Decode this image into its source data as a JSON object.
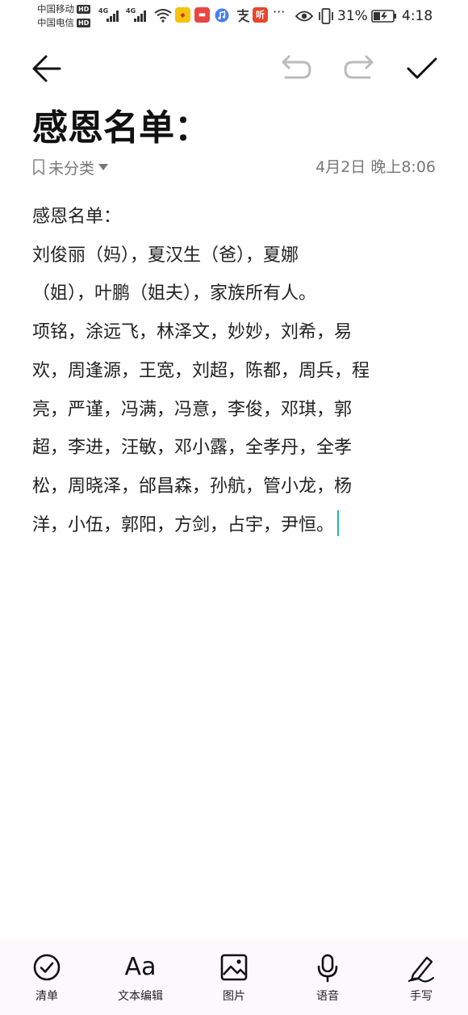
{
  "status_bar": {
    "carrier_1": "中国移动",
    "carrier_2": "中国电信",
    "hd_badge": "HD",
    "network_type": "4G",
    "battery_percent": "31%",
    "time": "4:18",
    "more_indicator": "···",
    "icons": [
      "signal-icon",
      "wifi-icon",
      "app-notification-icon",
      "music-icon",
      "alipay-icon",
      "ting-icon",
      "eye-icon",
      "vibrate-icon",
      "battery-icon"
    ]
  },
  "toolbar": {
    "back": "back-arrow-icon",
    "undo": "undo-icon",
    "redo": "redo-icon",
    "done": "checkmark-icon"
  },
  "note": {
    "title": "感恩名单：",
    "category": "未分类",
    "date": "4月2日 晚上8:06",
    "lines": [
      "感恩名单：",
      "刘俊丽（妈），夏汉生（爸），夏娜",
      "（姐），叶鹏（姐夫），家族所有人。",
      "项铭，涂远飞，林泽文，妙妙，刘希，易",
      "欢，周逢源，王宽，刘超，陈都，周兵，程",
      "亮，严谨，冯满，冯意，李俊，邓琪，郭",
      "超，李进，汪敏，邓小露，全孝丹，全孝",
      "松，周晓泽，邰昌森，孙航，管小龙，杨",
      "洋，小伍，郭阳，方剑，占宇，尹恒。"
    ]
  },
  "bottom_bar": {
    "items": [
      {
        "label": "清单",
        "icon": "checklist-icon"
      },
      {
        "label": "文本编辑",
        "icon": "text-format-icon",
        "glyph": "Aa"
      },
      {
        "label": "图片",
        "icon": "image-icon"
      },
      {
        "label": "语音",
        "icon": "microphone-icon"
      },
      {
        "label": "手写",
        "icon": "handwriting-icon"
      }
    ]
  },
  "colors": {
    "cursor": "#2bb3b1",
    "bottom_bar_bg": "#fdf8fb",
    "disabled_icon": "#bbbbbb",
    "text": "#222222"
  }
}
